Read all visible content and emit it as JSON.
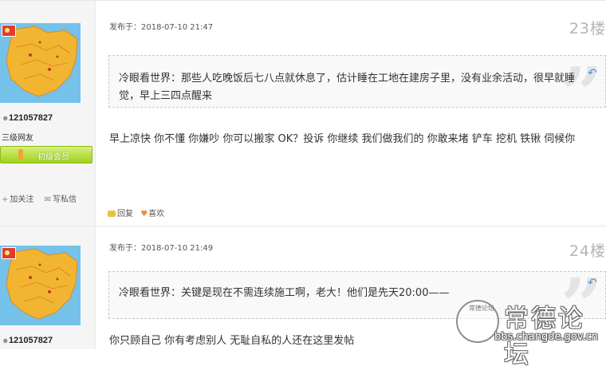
{
  "posts": [
    {
      "username": "121057827",
      "level": "三级网友",
      "medal": "初级会员",
      "follow_label": "加关注",
      "message_label": "写私信",
      "time": "发布于：2018-07-10 21:47",
      "floor": "23楼",
      "quote": "冷眼看世界：那些人吃晚饭后七八点就休息了，估计睡在工地在建房子里，没有业余活动，很早就睡觉，早上三四点醒来",
      "content": "早上凉快 你不懂 你嫌吵 你可以搬家 OK？投诉 你继续   我们做我们的 你敢来堵  铲车 挖机 铁锹 伺候你",
      "reply_label": "回复",
      "like_label": "喜欢"
    },
    {
      "username": "121057827",
      "time": "发布于：2018-07-10 21:49",
      "floor": "24楼",
      "quote": "冷眼看世界：关键是现在不需连续施工啊，老大！他们是先天20:00——",
      "content": "你只顾自己 你有考虑别人 无耻自私的人还在这里发帖"
    }
  ],
  "watermark": {
    "title": "常德论坛",
    "url": "bbs.changde.gov.cn",
    "seal_text": "常德论坛"
  },
  "colors": {
    "sidebar_bg": "#f5f5f5",
    "avatar_bg": "#74c2ea",
    "medal_green": "#9fd21f",
    "floor_gray": "#b4b4b4"
  }
}
